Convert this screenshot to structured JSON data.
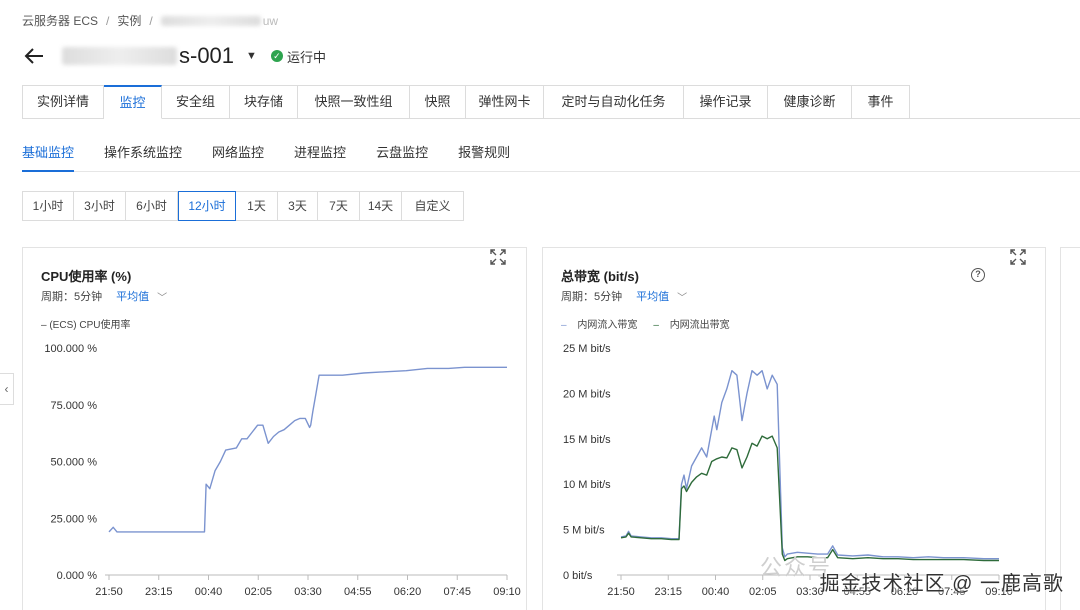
{
  "breadcrumb": {
    "root": "云服务器 ECS",
    "sep": "/",
    "level2": "实例",
    "level3_suffix": "uw"
  },
  "header": {
    "instance_suffix": "s-001",
    "status": "运行中",
    "status_color": "#2ea44f"
  },
  "tabs": [
    {
      "label": "实例详情"
    },
    {
      "label": "监控",
      "active": true
    },
    {
      "label": "安全组"
    },
    {
      "label": "块存储"
    },
    {
      "label": "快照一致性组"
    },
    {
      "label": "快照"
    },
    {
      "label": "弹性网卡"
    },
    {
      "label": "定时与自动化任务"
    },
    {
      "label": "操作记录"
    },
    {
      "label": "健康诊断"
    },
    {
      "label": "事件"
    }
  ],
  "subtabs": [
    {
      "label": "基础监控",
      "active": true
    },
    {
      "label": "操作系统监控"
    },
    {
      "label": "网络监控"
    },
    {
      "label": "进程监控"
    },
    {
      "label": "云盘监控"
    },
    {
      "label": "报警规则"
    }
  ],
  "time_ranges": [
    {
      "label": "1小时"
    },
    {
      "label": "3小时"
    },
    {
      "label": "6小时"
    },
    {
      "label": "12小时",
      "active": true
    },
    {
      "label": "1天"
    },
    {
      "label": "3天"
    },
    {
      "label": "7天"
    },
    {
      "label": "14天"
    },
    {
      "label": "自定义"
    }
  ],
  "accent_color": "#1a6ed8",
  "cpu_card": {
    "title": "CPU使用率 (%)",
    "period": "周期：5分钟",
    "agg": "平均值"
  },
  "bw_card": {
    "title": "总带宽 (bit/s)",
    "period": "周期：5分钟",
    "agg": "平均值"
  },
  "watermark": "掘金技术社区 @ 一鹿高歌",
  "watermark_faint": "公众号",
  "chart_data": [
    {
      "type": "line",
      "title": "CPU使用率 (%)",
      "ylim": [
        0,
        100
      ],
      "y_ticks": [
        "0.000 %",
        "25.000 %",
        "50.000 %",
        "75.000 %",
        "100.000 %"
      ],
      "x_ticks": [
        "21:50",
        "23:15",
        "00:40",
        "02:05",
        "03:30",
        "04:55",
        "06:20",
        "07:45",
        "09:10"
      ],
      "series": [
        {
          "name": "(ECS) CPU使用率",
          "color": "#7b93cf",
          "points": [
            [
              0,
              19
            ],
            [
              0.8,
              21
            ],
            [
              1.5,
              19
            ],
            [
              3,
              19
            ],
            [
              5,
              19
            ],
            [
              7,
              19
            ],
            [
              9,
              19
            ],
            [
              11,
              19
            ],
            [
              13,
              19
            ],
            [
              15,
              19
            ],
            [
              17,
              19
            ],
            [
              18,
              19
            ],
            [
              18.3,
              40
            ],
            [
              19,
              38
            ],
            [
              20,
              46
            ],
            [
              21,
              50
            ],
            [
              22,
              55
            ],
            [
              24,
              56
            ],
            [
              25,
              60
            ],
            [
              26,
              60
            ],
            [
              27,
              63
            ],
            [
              28,
              66
            ],
            [
              29,
              66
            ],
            [
              30,
              58
            ],
            [
              31,
              61
            ],
            [
              32,
              63
            ],
            [
              33,
              64
            ],
            [
              34,
              66
            ],
            [
              35,
              68
            ],
            [
              36,
              69
            ],
            [
              37,
              69
            ],
            [
              37.8,
              65
            ],
            [
              38,
              66
            ],
            [
              38.4,
              72
            ],
            [
              39,
              80
            ],
            [
              39.6,
              88
            ],
            [
              41,
              88
            ],
            [
              44,
              88
            ],
            [
              48,
              89
            ],
            [
              52,
              89.5
            ],
            [
              56,
              90
            ],
            [
              60,
              91
            ],
            [
              64,
              91
            ],
            [
              67,
              91.5
            ],
            [
              71,
              91.5
            ],
            [
              75,
              91.5
            ]
          ]
        }
      ]
    },
    {
      "type": "line",
      "title": "总带宽 (bit/s)",
      "ylim": [
        0,
        25
      ],
      "y_ticks": [
        "0  bit/s",
        "5 M bit/s",
        "10 M bit/s",
        "15 M bit/s",
        "20 M bit/s",
        "25 M bit/s"
      ],
      "x_ticks": [
        "21:50",
        "23:15",
        "00:40",
        "02:05",
        "03:30",
        "04:55",
        "06:20",
        "07:45",
        "09:10"
      ],
      "series": [
        {
          "name": "内网流入带宽",
          "color": "#7b93cf",
          "points": [
            [
              0,
              4.2
            ],
            [
              1,
              4.3
            ],
            [
              1.5,
              4.8
            ],
            [
              2,
              4.3
            ],
            [
              4,
              4.2
            ],
            [
              6,
              4.1
            ],
            [
              8,
              4.1
            ],
            [
              10,
              4
            ],
            [
              11.5,
              4
            ],
            [
              12,
              10
            ],
            [
              12.5,
              11
            ],
            [
              13,
              9.5
            ],
            [
              14,
              12
            ],
            [
              15,
              13
            ],
            [
              16,
              14
            ],
            [
              17,
              13
            ],
            [
              18,
              16
            ],
            [
              18.5,
              17.5
            ],
            [
              19,
              16
            ],
            [
              20,
              19
            ],
            [
              21,
              20.5
            ],
            [
              22,
              22.5
            ],
            [
              23,
              22
            ],
            [
              24,
              17
            ],
            [
              25,
              20
            ],
            [
              26,
              22.5
            ],
            [
              27,
              22
            ],
            [
              28,
              22.5
            ],
            [
              29,
              20.5
            ],
            [
              30,
              22
            ],
            [
              31,
              21
            ],
            [
              32,
              3
            ],
            [
              32.5,
              2
            ],
            [
              33,
              2.3
            ],
            [
              35,
              2.5
            ],
            [
              37,
              2.4
            ],
            [
              39,
              2.3
            ],
            [
              41,
              2.3
            ],
            [
              42,
              3.2
            ],
            [
              43,
              2.2
            ],
            [
              46,
              2.1
            ],
            [
              49,
              2.2
            ],
            [
              52,
              2
            ],
            [
              55,
              2
            ],
            [
              58,
              1.9
            ],
            [
              61,
              2
            ],
            [
              64,
              1.9
            ],
            [
              68,
              1.9
            ],
            [
              72,
              1.8
            ],
            [
              75,
              1.8
            ]
          ]
        },
        {
          "name": "内网流出带宽",
          "color": "#2e6b3a",
          "points": [
            [
              0,
              4.1
            ],
            [
              1,
              4.2
            ],
            [
              1.5,
              4.6
            ],
            [
              2,
              4.2
            ],
            [
              4,
              4.1
            ],
            [
              6,
              4
            ],
            [
              8,
              4
            ],
            [
              10,
              3.9
            ],
            [
              11.5,
              3.9
            ],
            [
              12,
              9.5
            ],
            [
              12.5,
              9.8
            ],
            [
              13,
              9.2
            ],
            [
              14,
              10.2
            ],
            [
              15,
              10.8
            ],
            [
              16,
              11.2
            ],
            [
              17,
              11
            ],
            [
              18,
              12.5
            ],
            [
              19,
              12.8
            ],
            [
              20,
              13
            ],
            [
              21,
              12.9
            ],
            [
              22,
              14
            ],
            [
              23,
              13.8
            ],
            [
              24,
              11.8
            ],
            [
              25,
              13
            ],
            [
              26,
              14.5
            ],
            [
              27,
              14.2
            ],
            [
              28,
              15.3
            ],
            [
              29,
              15
            ],
            [
              30,
              15.3
            ],
            [
              31,
              14
            ],
            [
              32,
              2.3
            ],
            [
              32.5,
              1.6
            ],
            [
              33,
              1.8
            ],
            [
              35,
              2
            ],
            [
              37,
              2
            ],
            [
              39,
              1.9
            ],
            [
              41,
              1.9
            ],
            [
              42,
              2.8
            ],
            [
              43,
              1.9
            ],
            [
              46,
              1.8
            ],
            [
              49,
              1.9
            ],
            [
              52,
              1.8
            ],
            [
              55,
              1.8
            ],
            [
              58,
              1.7
            ],
            [
              61,
              1.7
            ],
            [
              64,
              1.7
            ],
            [
              68,
              1.7
            ],
            [
              72,
              1.6
            ],
            [
              75,
              1.6
            ]
          ]
        }
      ]
    }
  ]
}
